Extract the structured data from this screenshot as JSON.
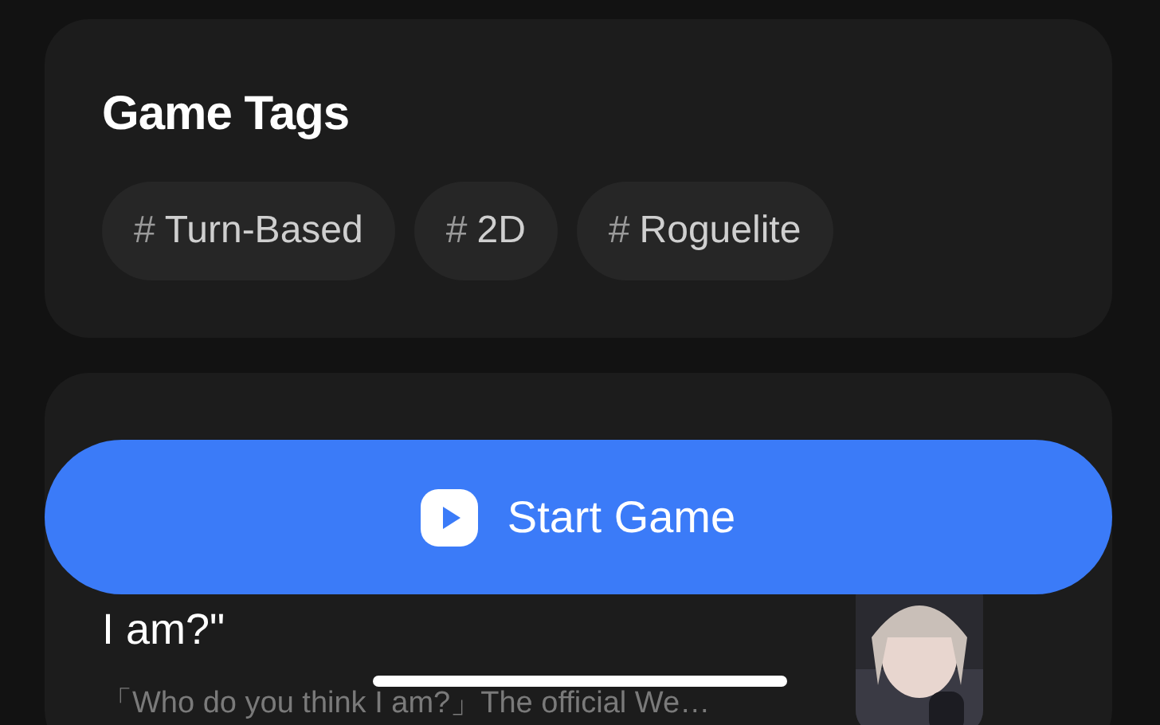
{
  "game_tags": {
    "title": "Game Tags",
    "tags": [
      {
        "symbol": "#",
        "label": "Turn-Based"
      },
      {
        "symbol": "#",
        "label": "2D"
      },
      {
        "symbol": "#",
        "label": "Roguelite"
      }
    ]
  },
  "episode": {
    "title": "I am?\"",
    "description": "「Who do you think I am?」The official We…"
  },
  "start_button": {
    "label": "Start Game"
  }
}
